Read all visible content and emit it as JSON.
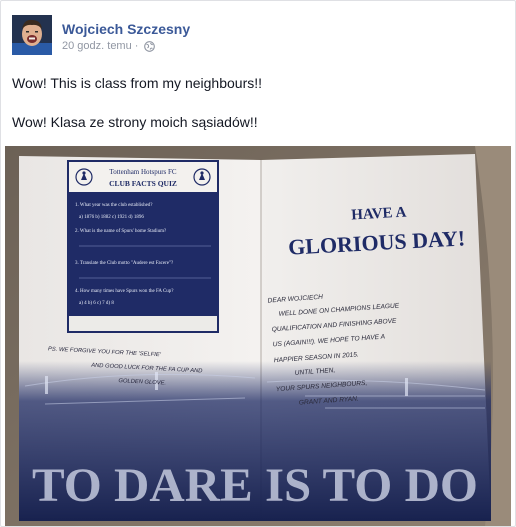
{
  "post": {
    "author": "Wojciech Szczesny",
    "timestamp": "20 godz. temu",
    "separator": "·",
    "privacy_icon": "globe-icon",
    "message_en": "Wow! This is class from my neighbours!!",
    "message_pl": "Wow! Klasa ze strony moich sąsiadów!!"
  },
  "photo": {
    "quiz": {
      "club": "Tottenham Hotspurs FC",
      "title": "CLUB FACTS QUIZ",
      "q1": "1. What year was the club established?",
      "q1_options": "a) 1876    b) 1882    c) 1921    d) 1896",
      "q2": "2. What is the name of Spurs' home Stadium?",
      "q3": "3. Translate the Club motto \"Audere est Facere\"?",
      "q4": "4. How many times have Spurs won the FA Cup?",
      "q4_options": "a) 4    b) 6    c) 7    d) 8"
    },
    "greeting_line1": "HAVE A",
    "greeting_line2": "GLORIOUS DAY!",
    "note": [
      "DEAR WOJCIECH",
      "WELL DONE ON CHAMPIONS LEAGUE",
      "QUALIFICATION AND FINISHING ABOVE",
      "US (AGAIN!!!). WE HOPE TO HAVE A",
      "HAPPIER SEASON IN 2015.",
      "UNTIL THEN,",
      "YOUR SPURS NEIGHBOURS,",
      "GRANT AND RYAN."
    ],
    "ps": [
      "PS.   WE FORGIVE YOU FOR THE 'SELFIE'",
      "AND GOOD LUCK FOR THE FA CUP AND",
      "GOLDEN GLOVE."
    ],
    "motto": "TO DARE IS TO DO"
  }
}
